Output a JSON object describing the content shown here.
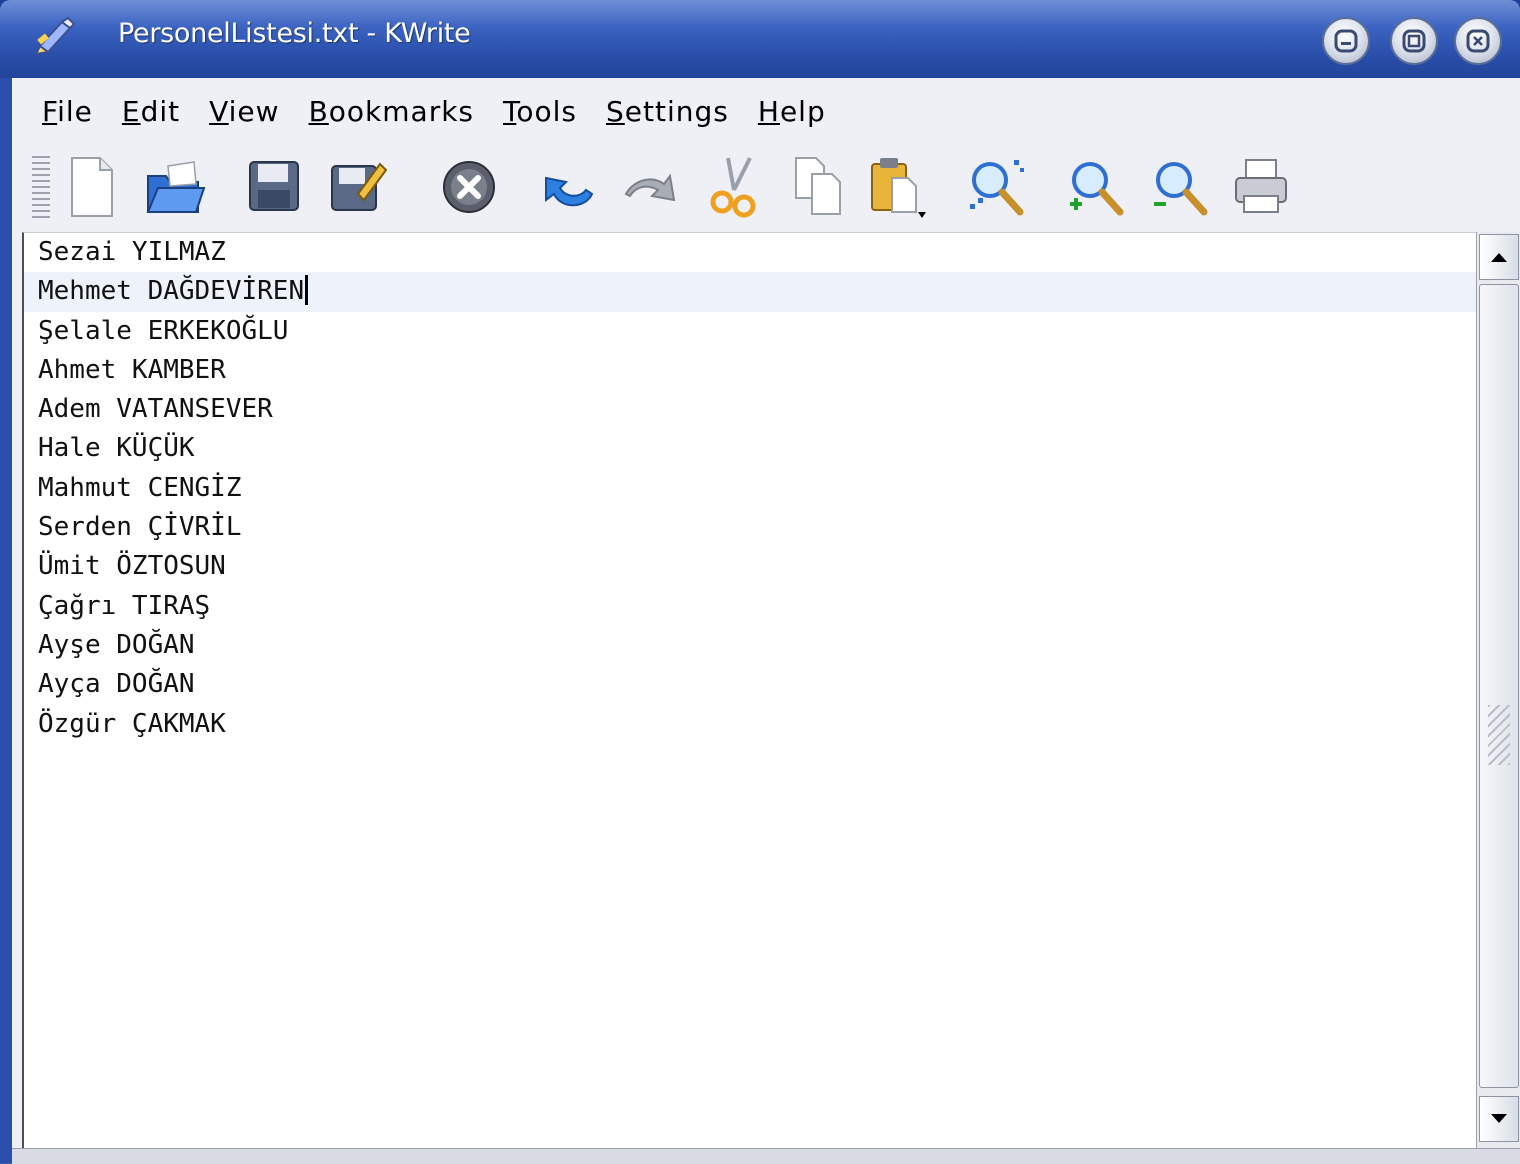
{
  "window": {
    "title": "PersonelListesi.txt - KWrite",
    "colors": {
      "titlebar": "#2a4fab",
      "frame": "#1a3f96"
    }
  },
  "menubar": {
    "items": [
      {
        "label": "File",
        "mnemonic": "F",
        "rest": "ile"
      },
      {
        "label": "Edit",
        "mnemonic": "E",
        "rest": "dit"
      },
      {
        "label": "View",
        "mnemonic": "V",
        "rest": "iew"
      },
      {
        "label": "Bookmarks",
        "mnemonic": "B",
        "rest": "ookmarks"
      },
      {
        "label": "Tools",
        "mnemonic": "T",
        "rest": "ools"
      },
      {
        "label": "Settings",
        "mnemonic": "S",
        "rest": "ettings"
      },
      {
        "label": "Help",
        "mnemonic": "H",
        "rest": "elp"
      }
    ]
  },
  "toolbar": {
    "buttons": [
      {
        "name": "new-document-icon"
      },
      {
        "name": "open-folder-icon"
      },
      {
        "name": "save-icon"
      },
      {
        "name": "save-as-icon"
      },
      {
        "name": "close-document-icon"
      },
      {
        "name": "undo-icon"
      },
      {
        "name": "redo-icon"
      },
      {
        "name": "cut-icon"
      },
      {
        "name": "copy-icon"
      },
      {
        "name": "paste-icon"
      },
      {
        "name": "find-icon"
      },
      {
        "name": "zoom-in-icon"
      },
      {
        "name": "zoom-out-icon"
      },
      {
        "name": "print-icon"
      }
    ]
  },
  "editor": {
    "current_line": 1,
    "lines": [
      "Sezai YILMAZ",
      "Mehmet DAĞDEVİREN",
      "Şelale ERKEKOĞLU",
      "Ahmet KAMBER",
      "Adem VATANSEVER",
      "Hale KÜÇÜK",
      "Mahmut CENGİZ",
      "Serden ÇİVRİL",
      "Ümit ÖZTOSUN",
      "Çağrı TIRAŞ",
      "Ayşe DOĞAN",
      "Ayça DOĞAN",
      "Özgür ÇAKMAK"
    ]
  }
}
